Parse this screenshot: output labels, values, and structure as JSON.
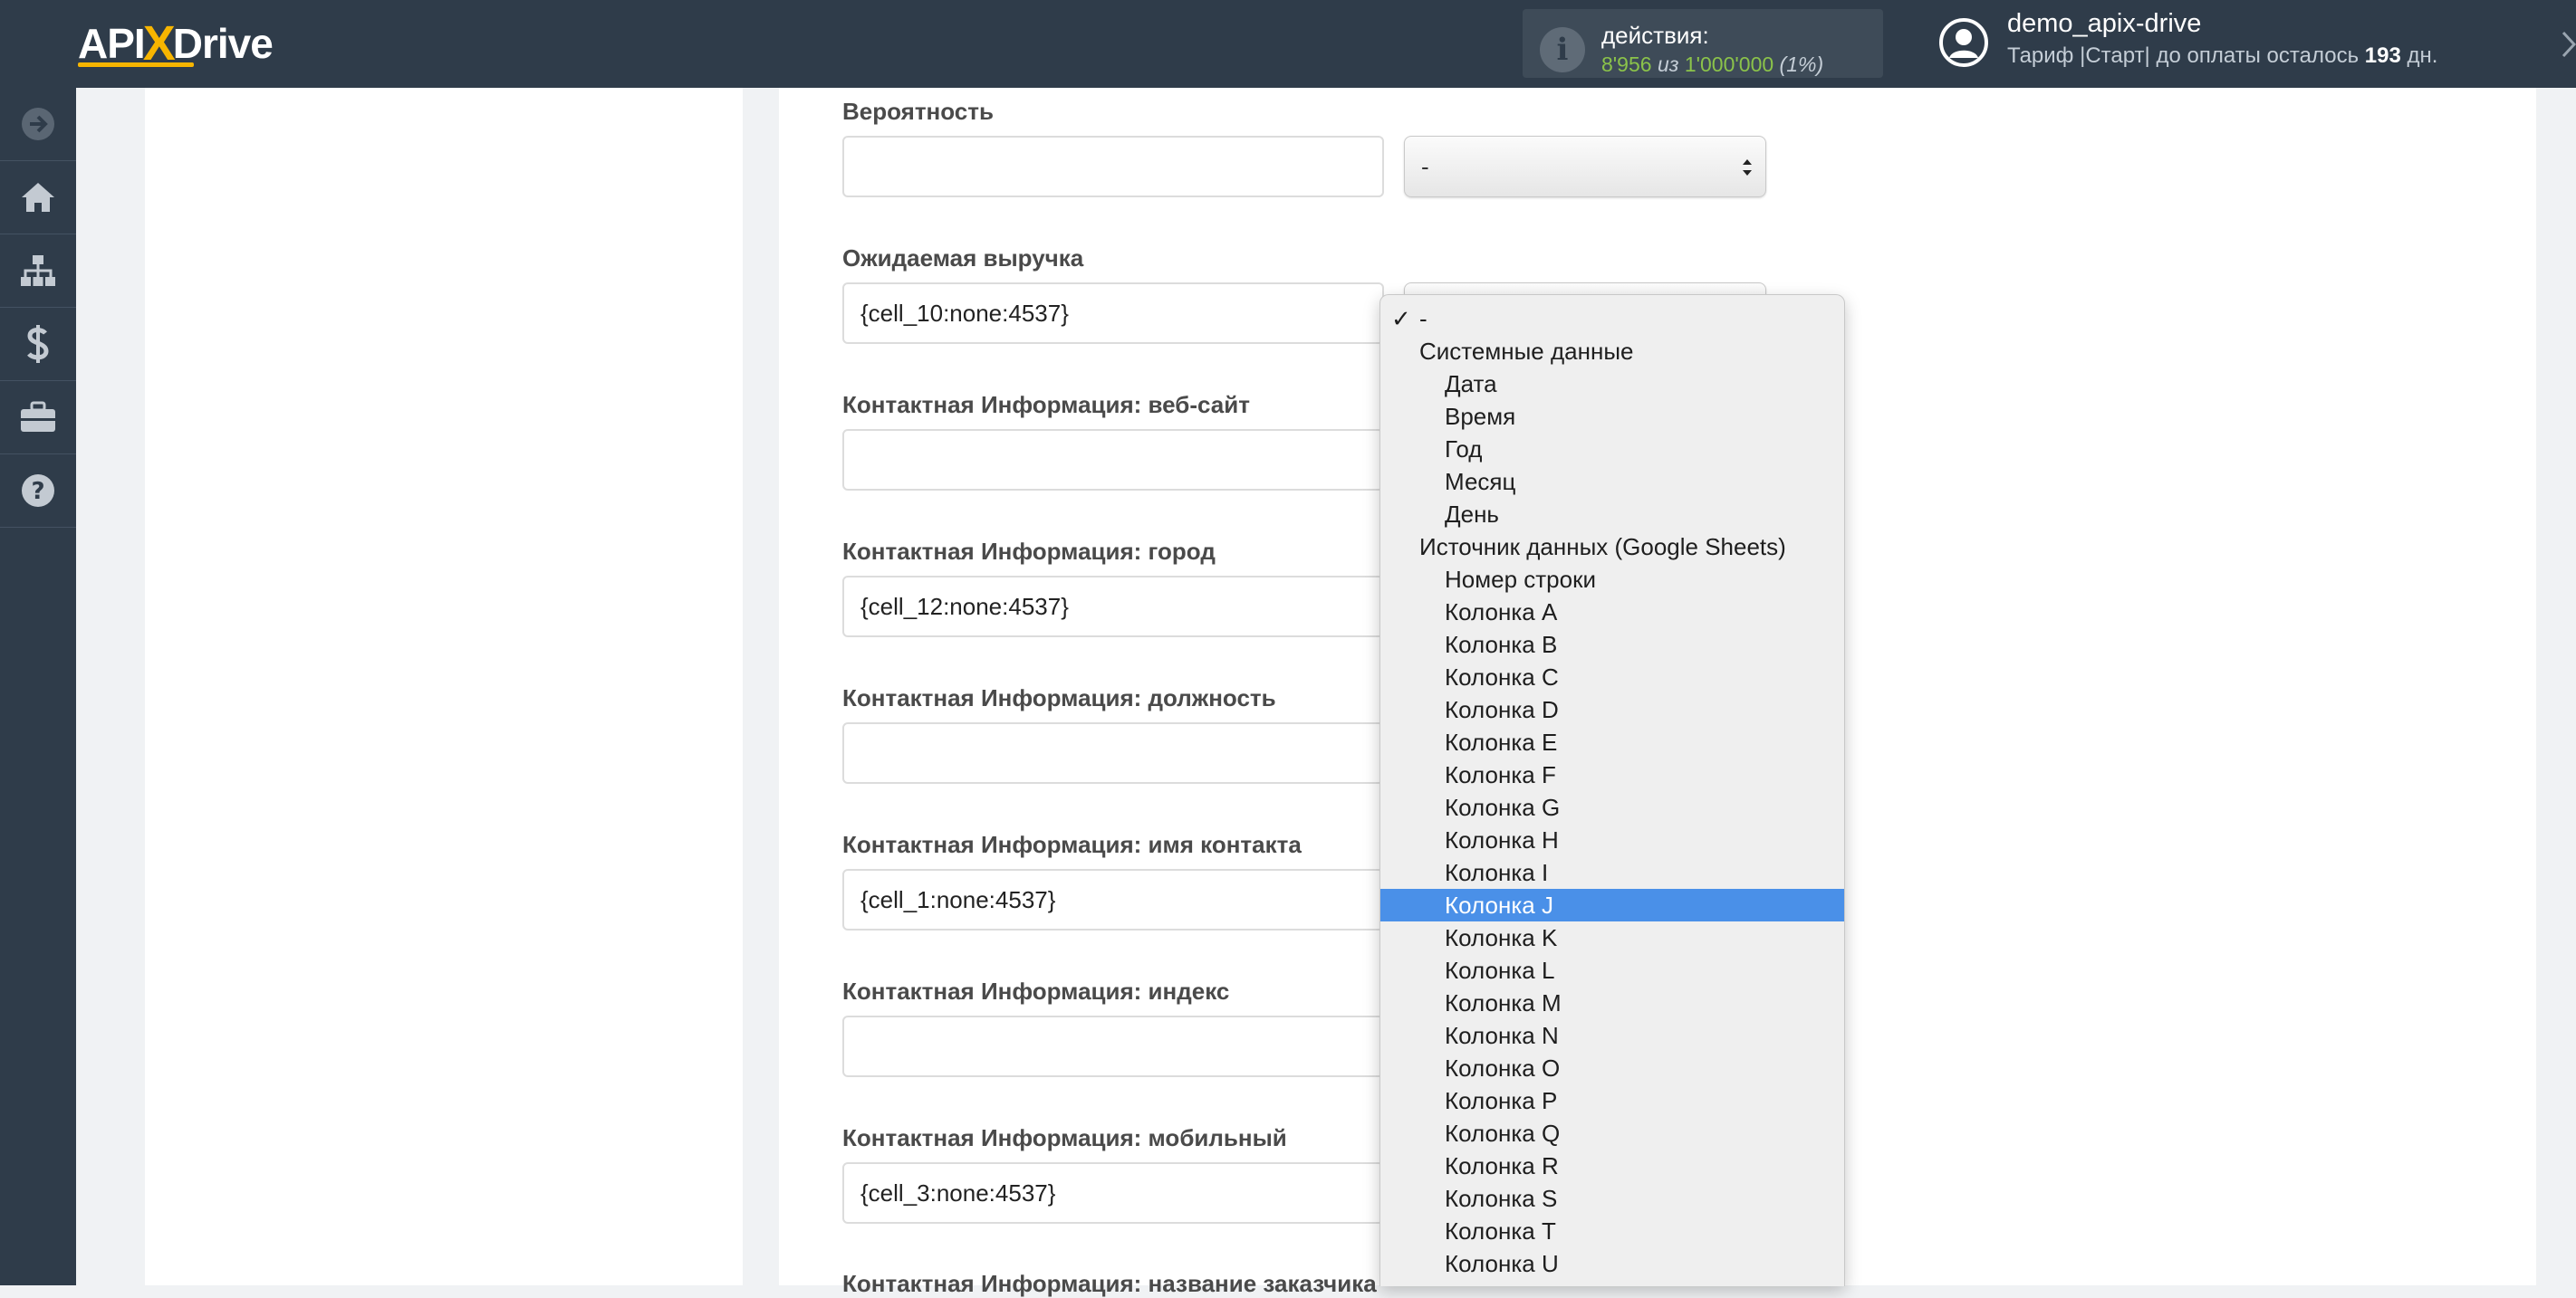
{
  "header": {
    "logo_prefix": "API",
    "logo_x": "X",
    "logo_suffix": "Drive",
    "actions_label": "действия:",
    "actions_used": "8'956",
    "actions_sep": "из",
    "actions_total": "1'000'000",
    "actions_pct": "(1%)",
    "user_name": "demo_apix-drive",
    "plan_text": "Тариф |Старт| до оплаты осталось",
    "plan_days": "193",
    "plan_days_unit": "дн."
  },
  "sidebar": {
    "items": [
      {
        "icon": "arrow-circle-right-icon"
      },
      {
        "icon": "home-icon"
      },
      {
        "icon": "sitemap-icon"
      },
      {
        "icon": "dollar-icon"
      },
      {
        "icon": "briefcase-icon"
      },
      {
        "icon": "question-circle-icon"
      }
    ]
  },
  "form": {
    "fields": [
      {
        "label": "Вероятность",
        "value": "",
        "select": "-"
      },
      {
        "label": "Ожидаемая выручка",
        "value": "{cell_10:none:4537}",
        "select": ""
      },
      {
        "label": "Контактная Информация: веб-сайт",
        "value": ""
      },
      {
        "label": "Контактная Информация: город",
        "value": "{cell_12:none:4537}"
      },
      {
        "label": "Контактная Информация: должность",
        "value": ""
      },
      {
        "label": "Контактная Информация: имя контакта",
        "value": "{cell_1:none:4537}"
      },
      {
        "label": "Контактная Информация: индекс",
        "value": ""
      },
      {
        "label": "Контактная Информация: мобильный",
        "value": "{cell_3:none:4537}"
      },
      {
        "label": "Контактная Информация: название заказчика",
        "value": ""
      }
    ]
  },
  "dropdown": {
    "selected_checked": "-",
    "options": [
      {
        "label": "-",
        "kind": "top",
        "checked": true
      },
      {
        "label": "Системные данные",
        "kind": "group"
      },
      {
        "label": "Дата",
        "kind": "item"
      },
      {
        "label": "Время",
        "kind": "item"
      },
      {
        "label": "Год",
        "kind": "item"
      },
      {
        "label": "Месяц",
        "kind": "item"
      },
      {
        "label": "День",
        "kind": "item"
      },
      {
        "label": "Источник данных (Google Sheets)",
        "kind": "group"
      },
      {
        "label": "Номер строки",
        "kind": "item"
      },
      {
        "label": "Колонка A",
        "kind": "item"
      },
      {
        "label": "Колонка B",
        "kind": "item"
      },
      {
        "label": "Колонка C",
        "kind": "item"
      },
      {
        "label": "Колонка D",
        "kind": "item"
      },
      {
        "label": "Колонка E",
        "kind": "item"
      },
      {
        "label": "Колонка F",
        "kind": "item"
      },
      {
        "label": "Колонка G",
        "kind": "item"
      },
      {
        "label": "Колонка H",
        "kind": "item"
      },
      {
        "label": "Колонка I",
        "kind": "item"
      },
      {
        "label": "Колонка J",
        "kind": "item",
        "highlighted": true
      },
      {
        "label": "Колонка K",
        "kind": "item"
      },
      {
        "label": "Колонка L",
        "kind": "item"
      },
      {
        "label": "Колонка M",
        "kind": "item"
      },
      {
        "label": "Колонка N",
        "kind": "item"
      },
      {
        "label": "Колонка O",
        "kind": "item"
      },
      {
        "label": "Колонка P",
        "kind": "item"
      },
      {
        "label": "Колонка Q",
        "kind": "item"
      },
      {
        "label": "Колонка R",
        "kind": "item"
      },
      {
        "label": "Колонка S",
        "kind": "item"
      },
      {
        "label": "Колонка T",
        "kind": "item"
      },
      {
        "label": "Колонка U",
        "kind": "item"
      }
    ]
  },
  "colors": {
    "topbar": "#2f3c4a",
    "highlight": "#4a90e8",
    "actions_used": "#8bc34a",
    "logo_accent": "#f7b500"
  }
}
